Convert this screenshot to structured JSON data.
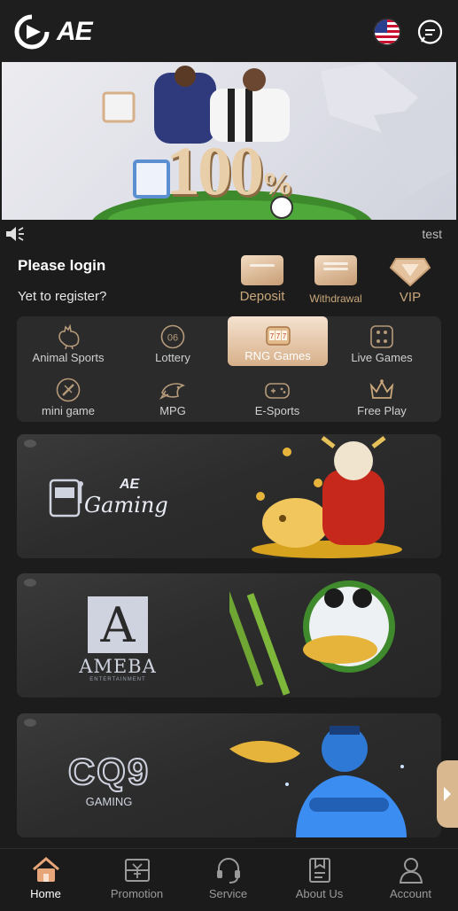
{
  "header": {
    "logo_text": "AE",
    "language_icon": "us-flag-icon",
    "chat_icon": "chat-bubble-icon"
  },
  "banner": {
    "headline": "100",
    "headline_suffix": "%"
  },
  "notice": {
    "icon": "speaker-icon",
    "text": "test"
  },
  "account_area": {
    "login_title": "Please login",
    "register_text": "Yet to register?"
  },
  "quick_actions": [
    {
      "label": "Deposit",
      "icon": "wallet-card-icon"
    },
    {
      "label": "Withdrawal",
      "icon": "bank-card-icon"
    },
    {
      "label": "VIP",
      "icon": "vip-diamond-icon"
    }
  ],
  "categories": [
    {
      "label": "Animal Sports",
      "icon": "rooster-icon"
    },
    {
      "label": "Lottery",
      "icon": "lottery-ball-icon"
    },
    {
      "label": "RNG Games",
      "icon": "slot-machine-icon"
    },
    {
      "label": "Live Games",
      "icon": "dice-icon"
    },
    {
      "label": "mini game",
      "icon": "mini-game-icon"
    },
    {
      "label": "MPG",
      "icon": "fish-icon"
    },
    {
      "label": "E-Sports",
      "icon": "gamepad-icon"
    },
    {
      "label": "Free Play",
      "icon": "crown-icon"
    }
  ],
  "active_category": "RNG Games",
  "providers": [
    {
      "name": "AE Gaming",
      "logo_text": "Gaming",
      "logo_prefix": "AE"
    },
    {
      "name": "AMEBA",
      "logo_letter": "A",
      "logo_text": "AMEBA",
      "logo_sub": "ENTERTAINMENT"
    },
    {
      "name": "CQ9 Gaming",
      "logo_text": "CQ9",
      "logo_sub": "GAMING"
    }
  ],
  "bottom_nav": [
    {
      "label": "Home",
      "icon": "home-icon",
      "active": true
    },
    {
      "label": "Promotion",
      "icon": "promotion-icon",
      "active": false
    },
    {
      "label": "Service",
      "icon": "headset-icon",
      "active": false
    },
    {
      "label": "About Us",
      "icon": "about-us-icon",
      "active": false
    },
    {
      "label": "Account",
      "icon": "user-icon",
      "active": false
    }
  ],
  "colors": {
    "background": "#1c1c1c",
    "panel": "#2b2b2b",
    "accent_gold": "#c9a77a",
    "active_tab": "#d7b08a"
  }
}
